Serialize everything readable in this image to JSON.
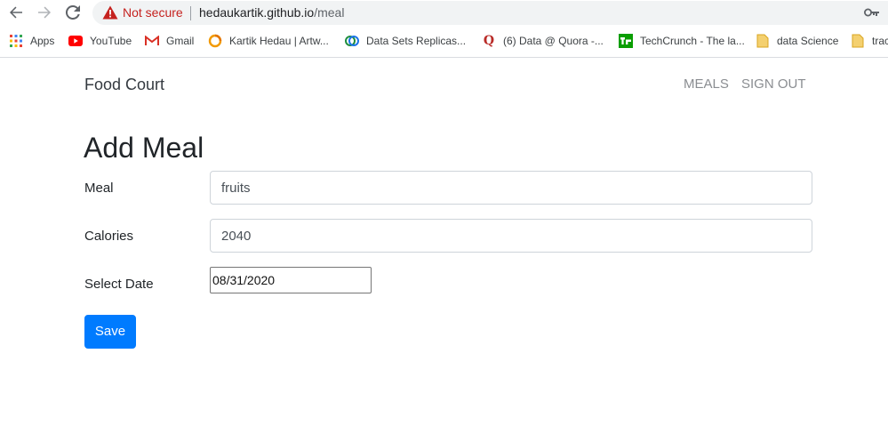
{
  "browser": {
    "security_label": "Not secure",
    "url_host": "hedaukartik.github.io",
    "url_path": "/meal",
    "bookmarks": [
      {
        "label": "Apps",
        "icon": "apps-grid-icon"
      },
      {
        "label": "YouTube",
        "icon": "youtube-icon",
        "color": "#ff0000"
      },
      {
        "label": "Gmail",
        "icon": "gmail-icon",
        "color": "#d93025"
      },
      {
        "label": "Kartik Hedau | Artw...",
        "icon": "artwork-ring-icon",
        "color": "#f29900"
      },
      {
        "label": "Data Sets Replicas...",
        "icon": "data-sets-icon",
        "color": "#1e8e3e"
      },
      {
        "label": "(6) Data @ Quora -...",
        "icon": "quora-icon",
        "color": "#b92b27"
      },
      {
        "label": "TechCrunch - The la...",
        "icon": "techcrunch-icon",
        "color": "#0a9e01"
      },
      {
        "label": "data Science",
        "icon": "folder-icon",
        "color": "#f4d06f"
      },
      {
        "label": "trac",
        "icon": "folder-icon",
        "color": "#f4d06f"
      }
    ]
  },
  "navbar": {
    "brand": "Food Court",
    "links": [
      "MEALS",
      "SIGN OUT"
    ]
  },
  "form": {
    "title": "Add Meal",
    "meal_label": "Meal",
    "meal_value": "fruits",
    "calories_label": "Calories",
    "calories_value": "2040",
    "date_label": "Select Date",
    "date_value": "08/31/2020",
    "save_label": "Save"
  },
  "colors": {
    "primary": "#007bff",
    "warning": "#c5221f"
  }
}
